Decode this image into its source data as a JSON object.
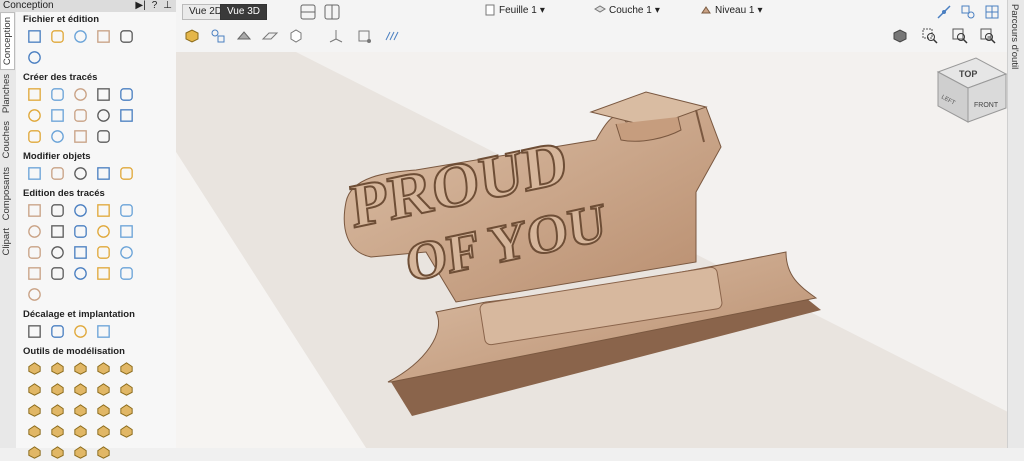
{
  "window": {
    "title": "Conception"
  },
  "left_tabs": [
    "Conception",
    "Planches",
    "Couches",
    "Composants",
    "Clipart"
  ],
  "right_tab": "Parcours d'outil",
  "panel": {
    "sections": [
      {
        "title": "Fichier et édition",
        "tools": [
          "crop-icon",
          "open-folder-icon",
          "save-icon",
          "import-icon",
          "texture-icon",
          "flatten-icon"
        ]
      },
      {
        "title": "Créer des tracés",
        "tools": [
          "circle-icon",
          "ellipse-icon",
          "rectangle-icon",
          "polygon-icon",
          "star-icon",
          "line-icon",
          "arc-icon",
          "curve-icon",
          "wave-icon",
          "dimension-icon",
          "text-icon",
          "text-outline-icon",
          "text-on-curve-icon",
          "image-trace-icon"
        ]
      },
      {
        "title": "Modifier objets",
        "tools": [
          "move-icon",
          "scale-icon",
          "rotate-icon",
          "mirror-icon",
          "align-icon"
        ]
      },
      {
        "title": "Edition des tracés",
        "tools": [
          "select-icon",
          "node-edit-icon",
          "node-add-icon",
          "transform-icon",
          "link-icon",
          "measure-icon",
          "weld-icon",
          "subtract-icon",
          "intersect-icon",
          "trim-icon",
          "scissors-icon",
          "check-icon",
          "fillet-icon",
          "smooth-icon",
          "join-icon",
          "extend-icon",
          "offset-curve-icon",
          "close-icon",
          "rounded-rect-icon",
          "spline-icon",
          "arrow-icon"
        ]
      },
      {
        "title": "Décalage et implantation",
        "tools": [
          "offset-icon",
          "nesting-icon",
          "array-icon",
          "qr-icon"
        ]
      },
      {
        "title": "Outils de modélisation",
        "tools": [
          "model-1-icon",
          "model-2-icon",
          "model-3-icon",
          "model-4-icon",
          "model-5-icon",
          "model-6-icon",
          "model-7-icon",
          "model-8-icon",
          "model-9-icon",
          "model-10-icon",
          "model-11-icon",
          "model-12-icon",
          "model-13-icon",
          "model-14-icon",
          "model-15-icon",
          "model-16-icon",
          "model-17-icon",
          "model-18-icon",
          "model-19-icon",
          "model-20-icon",
          "model-21-icon",
          "model-22-icon",
          "model-23-icon",
          "model-24-icon"
        ]
      }
    ]
  },
  "toolbar": {
    "view2d": "Vue 2D",
    "view3d": "Vue 3D",
    "sheet": "Feuille 1",
    "layer": "Couche 1",
    "level": "Niveau 1"
  },
  "viewcube": {
    "top": "TOP",
    "front": "FRONT",
    "left": "LEFT"
  },
  "model": {
    "line1": "PROUD",
    "line2": "OF YOU"
  },
  "colors": {
    "wood": "#c9a285",
    "wood_dark": "#8a644b",
    "backdrop": "#e9e4df"
  }
}
